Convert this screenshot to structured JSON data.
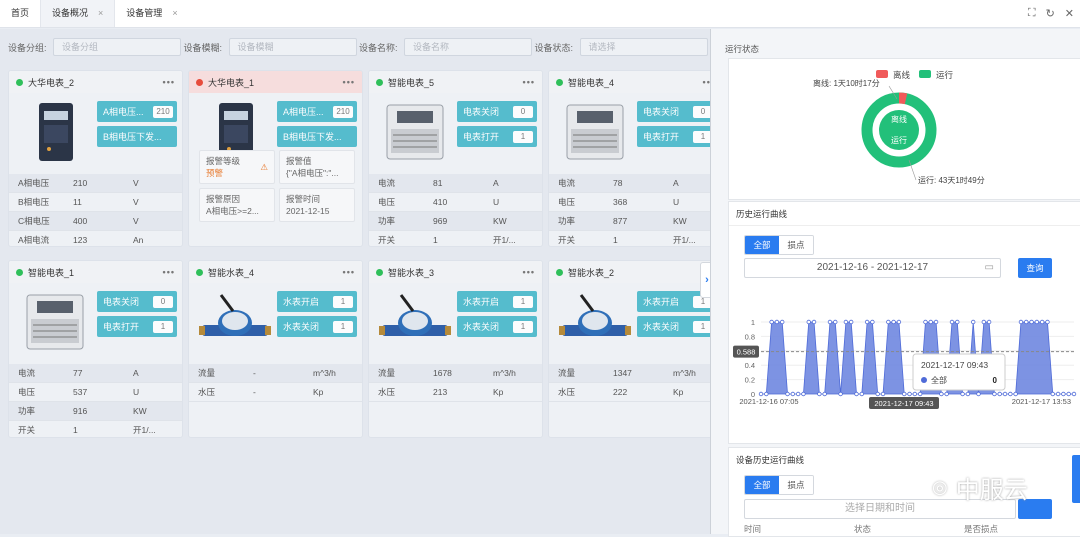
{
  "tabs": [
    {
      "label": "首页"
    },
    {
      "label": "设备概况",
      "active": true
    },
    {
      "label": "设备管理"
    }
  ],
  "tab_close_glyph": "×",
  "filters": [
    {
      "label": "设备分组:",
      "placeholder": "设备分组"
    },
    {
      "label": "设备模糊:",
      "placeholder": "设备模糊"
    },
    {
      "label": "设备名称:",
      "placeholder": "设备名称"
    },
    {
      "label": "设备状态:",
      "placeholder": "请选择"
    }
  ],
  "cards": [
    {
      "name": "大华电表_2",
      "status": "online",
      "buttons": [
        {
          "label": "A相电压...",
          "value": "210"
        },
        {
          "label": "B相电压下发...",
          "value": ""
        }
      ],
      "rows": [
        [
          "A相电压",
          "210",
          "V"
        ],
        [
          "B相电压",
          "11",
          "V"
        ],
        [
          "C相电压",
          "400",
          "V"
        ],
        [
          "A相电流",
          "123",
          "An"
        ]
      ]
    },
    {
      "name": "大华电表_1",
      "status": "alarm",
      "buttons": [
        {
          "label": "A相电压...",
          "value": "210"
        },
        {
          "label": "B相电压下发...",
          "value": ""
        }
      ],
      "alarm": {
        "level_label": "报警等级",
        "level_value": "预警",
        "value_label": "报警值",
        "value_text": "{\"A相电压\":\"...",
        "reason_label": "报警原因",
        "reason_text": "A相电压>=2...",
        "time_label": "报警时间",
        "time_text": "2021-12-15"
      }
    },
    {
      "name": "智能电表_5",
      "status": "online",
      "buttons": [
        {
          "label": "电表关闭",
          "value": "0"
        },
        {
          "label": "电表打开",
          "value": "1"
        }
      ],
      "rows": [
        [
          "电流",
          "81",
          "A"
        ],
        [
          "电压",
          "410",
          "U"
        ],
        [
          "功率",
          "969",
          "KW"
        ],
        [
          "开关",
          "1",
          "开1/..."
        ]
      ]
    },
    {
      "name": "智能电表_4",
      "status": "online",
      "buttons": [
        {
          "label": "电表关闭",
          "value": "0"
        },
        {
          "label": "电表打开",
          "value": "1"
        }
      ],
      "rows": [
        [
          "电流",
          "78",
          "A"
        ],
        [
          "电压",
          "368",
          "U"
        ],
        [
          "功率",
          "877",
          "KW"
        ],
        [
          "开关",
          "1",
          "开1/..."
        ]
      ]
    },
    {
      "name": "智能电表_1",
      "status": "online",
      "buttons": [
        {
          "label": "电表关闭",
          "value": "0"
        },
        {
          "label": "电表打开",
          "value": "1"
        }
      ],
      "rows": [
        [
          "电流",
          "77",
          "A"
        ],
        [
          "电压",
          "537",
          "U"
        ],
        [
          "功率",
          "916",
          "KW"
        ],
        [
          "开关",
          "1",
          "开1/..."
        ]
      ]
    },
    {
      "name": "智能水表_4",
      "status": "online",
      "buttons": [
        {
          "label": "水表开启",
          "value": "1"
        },
        {
          "label": "水表关闭",
          "value": "1"
        }
      ],
      "rows": [
        [
          "流量",
          "-",
          "m^3/h"
        ],
        [
          "水压",
          "-",
          "Kp"
        ]
      ]
    },
    {
      "name": "智能水表_3",
      "status": "online",
      "buttons": [
        {
          "label": "水表开启",
          "value": "1"
        },
        {
          "label": "水表关闭",
          "value": "1"
        }
      ],
      "rows": [
        [
          "流量",
          "1678",
          "m^3/h"
        ],
        [
          "水压",
          "213",
          "Kp"
        ]
      ]
    },
    {
      "name": "智能水表_2",
      "status": "online",
      "buttons": [
        {
          "label": "水表开启",
          "value": "1"
        },
        {
          "label": "水表关闭",
          "value": "1"
        }
      ],
      "rows": [
        [
          "流量",
          "1347",
          "m^3/h"
        ],
        [
          "水压",
          "222",
          "Kp"
        ]
      ]
    }
  ],
  "more_glyph": "•••",
  "right": {
    "title": "运行状态",
    "status_chart": {
      "legend": [
        {
          "name": "离线",
          "color": "#f05a5a"
        },
        {
          "name": "运行",
          "color": "#22c07a"
        }
      ],
      "offline_label": "离线: 1天10时17分",
      "running_label": "运行: 43天1时49分",
      "center_top": "离线",
      "center_bottom": "运行"
    },
    "history": {
      "title": "历史运行曲线",
      "seg": [
        "全部",
        "损点"
      ],
      "daterange": "2021-12-16 - 2021-12-17",
      "query": "查询",
      "tooltip_time": "2021-12-17 09:43",
      "tooltip_series": "全部",
      "tooltip_value": "0",
      "pointer_value": "0.588",
      "pointer_time": "2021-12-17 09:43"
    },
    "device_history": {
      "title": "设备历史运行曲线",
      "seg": [
        "全部",
        "损点"
      ],
      "date_placeholder": "选择日期和时间",
      "columns": [
        "时间",
        "状态",
        "是否损点"
      ]
    }
  },
  "watermark": "中服云",
  "chart_data": {
    "type": "area",
    "x": [
      "2021-12-16 07:05",
      "2021-12-16 22:00",
      "2021-12-17 13:53"
    ],
    "yticks": [
      0,
      0.2,
      0.4,
      0.6,
      0.8,
      1
    ],
    "ylim": [
      0,
      1
    ],
    "series": [
      {
        "name": "全部",
        "values": [
          0,
          0,
          1,
          1,
          1,
          0,
          0,
          0,
          0,
          1,
          1,
          0,
          0,
          1,
          1,
          0,
          1,
          1,
          0,
          0,
          1,
          1,
          0,
          0,
          1,
          1,
          1,
          0,
          0,
          0,
          0,
          1,
          1,
          1,
          0,
          0,
          1,
          1,
          0,
          0,
          1,
          0,
          1,
          1,
          0,
          0,
          0,
          0,
          0,
          1,
          1,
          1,
          1,
          1,
          1,
          0,
          0,
          0,
          0,
          0
        ],
        "color": "#6f87e0"
      }
    ],
    "xtick_labels": [
      "2021-12-16 07:05",
      "2021-12-16 22:00",
      "2021-12-17 13:53"
    ],
    "marker_line": 0.588
  }
}
